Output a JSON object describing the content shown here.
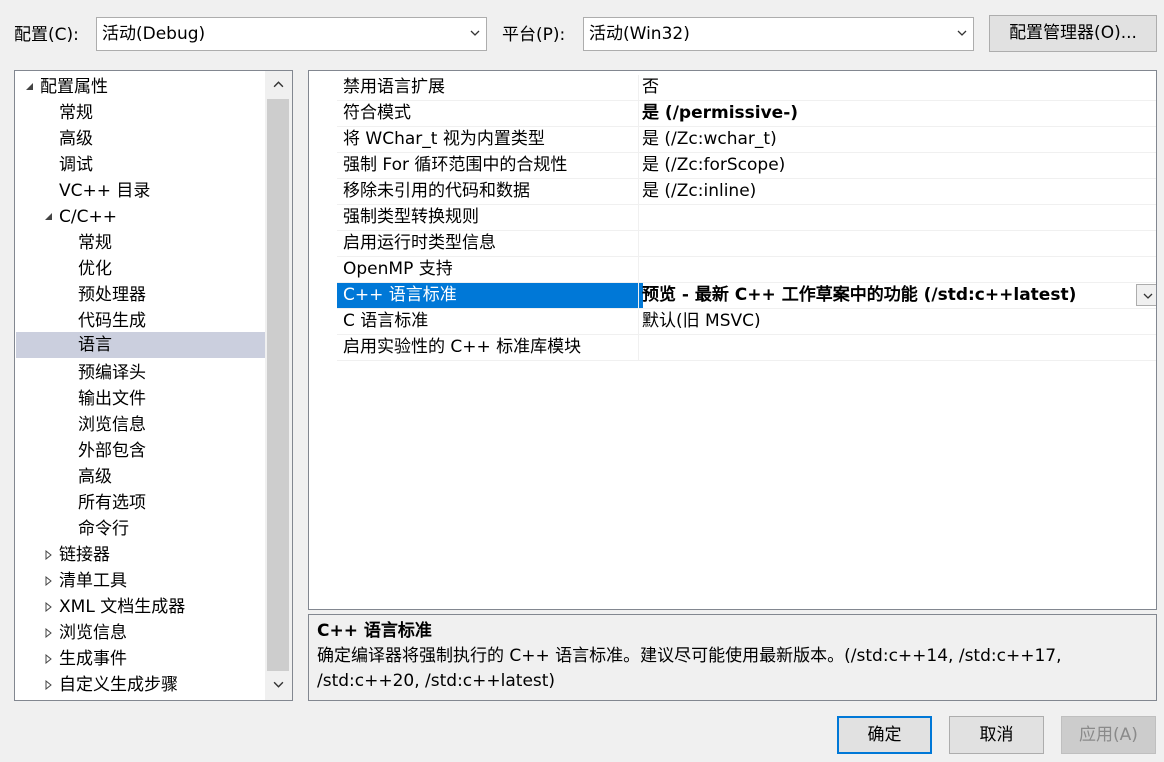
{
  "top": {
    "config_label": "配置(C):",
    "config_value": "活动(Debug)",
    "platform_label": "平台(P):",
    "platform_value": "活动(Win32)",
    "config_manager_button": "配置管理器(O)..."
  },
  "tree": {
    "items": [
      {
        "label": "配置属性"
      },
      {
        "label": "常规"
      },
      {
        "label": "高级"
      },
      {
        "label": "调试"
      },
      {
        "label": "VC++ 目录"
      },
      {
        "label": "C/C++"
      },
      {
        "label": "常规"
      },
      {
        "label": "优化"
      },
      {
        "label": "预处理器"
      },
      {
        "label": "代码生成"
      },
      {
        "label": "语言"
      },
      {
        "label": "预编译头"
      },
      {
        "label": "输出文件"
      },
      {
        "label": "浏览信息"
      },
      {
        "label": "外部包含"
      },
      {
        "label": "高级"
      },
      {
        "label": "所有选项"
      },
      {
        "label": "命令行"
      },
      {
        "label": "链接器"
      },
      {
        "label": "清单工具"
      },
      {
        "label": "XML 文档生成器"
      },
      {
        "label": "浏览信息"
      },
      {
        "label": "生成事件"
      },
      {
        "label": "自定义生成步骤"
      }
    ]
  },
  "grid": {
    "rows": [
      {
        "name": "禁用语言扩展",
        "value": "否"
      },
      {
        "name": "符合模式",
        "value": "是 (/permissive-)"
      },
      {
        "name": "将 WChar_t 视为内置类型",
        "value": "是 (/Zc:wchar_t)"
      },
      {
        "name": "强制 For 循环范围中的合规性",
        "value": "是 (/Zc:forScope)"
      },
      {
        "name": "移除未引用的代码和数据",
        "value": "是 (/Zc:inline)"
      },
      {
        "name": "强制类型转换规则",
        "value": ""
      },
      {
        "name": "启用运行时类型信息",
        "value": ""
      },
      {
        "name": "OpenMP 支持",
        "value": ""
      },
      {
        "name": "C++ 语言标准",
        "value": "预览 - 最新 C++ 工作草案中的功能 (/std:c++latest)"
      },
      {
        "name": "C 语言标准",
        "value": "默认(旧 MSVC)"
      },
      {
        "name": "启用实验性的 C++ 标准库模块",
        "value": ""
      }
    ]
  },
  "description": {
    "title": "C++ 语言标准",
    "line1": "确定编译器将强制执行的 C++ 语言标准。建议尽可能使用最新版本。(/std:c++14, /std:c++17,",
    "line2": "/std:c++20, /std:c++latest)"
  },
  "buttons": {
    "ok": "确定",
    "cancel": "取消",
    "apply": "应用(A)"
  },
  "colors": {
    "selection": "#0078d7",
    "tree_selection": "#cbcfde",
    "dialog_bg": "#f0f0f0"
  }
}
